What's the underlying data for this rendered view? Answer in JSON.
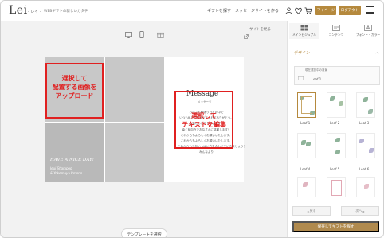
{
  "header": {
    "logo": "Lei",
    "logo_sub": "- レイ -",
    "tagline": "WEBギフトの新しいカタチ",
    "nav_gift": "ギフトを探す",
    "nav_message": "メッセージサイトを作る",
    "mypage_label": "マイページ",
    "logout_label": "ログアウト",
    "cart_count": "0"
  },
  "workspace": {
    "view_site_label": "サイトを見る",
    "device_icons": [
      "desktop-icon",
      "mobile-icon",
      "gift-icon"
    ],
    "template_button": "テンプレートを選択"
  },
  "canvas": {
    "overlay_title": "HAVE A NICE DAY!",
    "overlay_names": [
      "Ieui Shampoo",
      "& Yokemaya Rmono"
    ],
    "message_title": "Message",
    "message_sub": "メッセージ",
    "message_lines": [
      "おなさん頑張り日々の中で",
      "いつも私たちを支えてくれてありがとう。",
      "心強かったりしています。",
      "幸く前向きでおなさんに感謝します！",
      "これからもよろしくお願いいたします。",
      "これからもよろしくお願いいたします。",
      "これからも元気いっぱい力を合わせていきましょう！",
      "みんなより"
    ],
    "annotation_upload": [
      "選択して",
      "配置する画像を",
      "アップロード"
    ],
    "annotation_edit": [
      "選択して",
      "テキストを編集"
    ]
  },
  "panel": {
    "tabs": [
      {
        "label": "メインビジュアル",
        "icon": "grid-icon",
        "active": true
      },
      {
        "label": "コンテンツ",
        "icon": "content-icon",
        "active": false
      },
      {
        "label": "フォント・カラー",
        "icon": "font-color-icon",
        "active": false
      }
    ],
    "design_label": "デザイン",
    "selected_caption": "現在選択中の背景",
    "selected_name": "Leaf 1",
    "templates": [
      {
        "label": "Leaf 1",
        "selected": true
      },
      {
        "label": "Leaf 2",
        "selected": false
      },
      {
        "label": "Leaf 3",
        "selected": false
      },
      {
        "label": "Leaf 4",
        "selected": false
      },
      {
        "label": "Leaf 5",
        "selected": false
      },
      {
        "label": "Leaf 6",
        "selected": false
      },
      {
        "label": "",
        "selected": false
      },
      {
        "label": "",
        "selected": false
      },
      {
        "label": "",
        "selected": false
      }
    ],
    "prev_label": "戻る",
    "next_label": "次へ",
    "save_label": "保存してギフトを探す"
  },
  "colors": {
    "accent": "#b5893d",
    "annotation": "#e02020",
    "photo_placeholder": "#c8c8c8"
  }
}
